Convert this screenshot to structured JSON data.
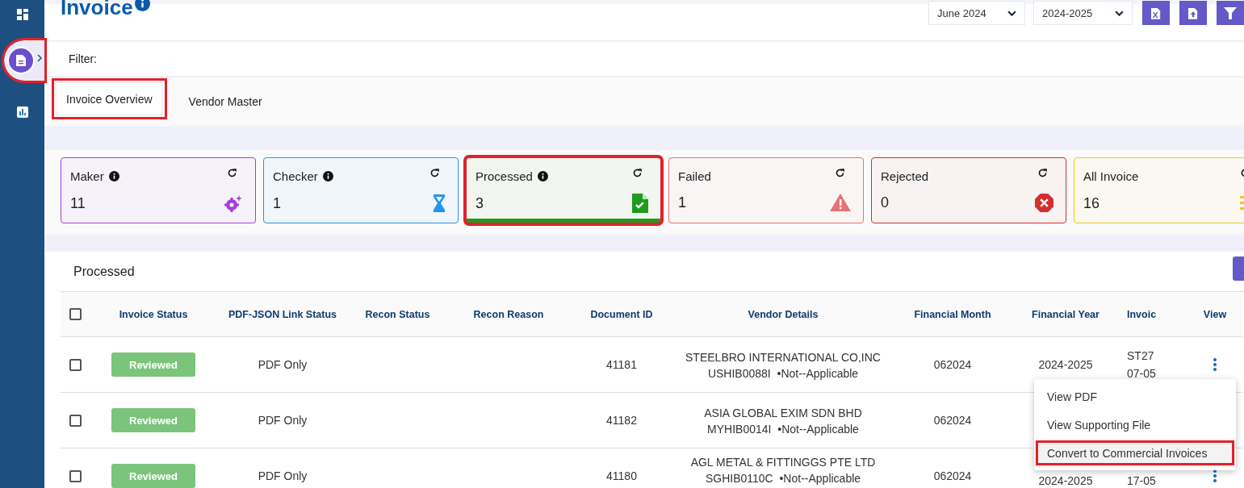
{
  "sidebar": {
    "items": [
      {
        "kind": "dashboard",
        "selected": false,
        "highlighted": false
      },
      {
        "kind": "document",
        "selected": true,
        "highlighted": true
      },
      {
        "kind": "chart",
        "selected": false,
        "highlighted": false
      }
    ]
  },
  "header": {
    "title": "Invoice",
    "month": "June 2024",
    "year": "2024-2025",
    "actions": [
      {
        "kind": "excel"
      },
      {
        "kind": "upload"
      },
      {
        "kind": "filter"
      }
    ]
  },
  "filter": {
    "label": "Filter:"
  },
  "tabs": [
    {
      "label": "Invoice Overview",
      "selected": true,
      "highlighted": true
    },
    {
      "label": "Vendor Master",
      "selected": false,
      "highlighted": false
    }
  ],
  "cards": [
    {
      "label": "Maker",
      "count": "11",
      "info": true,
      "kind": "gear",
      "color": "#a43fd9",
      "selected": false,
      "highlighted": false
    },
    {
      "label": "Checker",
      "count": "1",
      "info": true,
      "kind": "hourglass",
      "color": "#2196f3",
      "selected": false,
      "highlighted": false
    },
    {
      "label": "Processed",
      "count": "3",
      "info": true,
      "kind": "file-check",
      "color": "#1e9a1e",
      "selected": true,
      "highlighted": true
    },
    {
      "label": "Failed",
      "count": "1",
      "info": false,
      "kind": "warning",
      "color": "#e57373",
      "selected": false,
      "highlighted": false
    },
    {
      "label": "Rejected",
      "count": "0",
      "info": false,
      "kind": "cancel",
      "color": "#d32f2f",
      "selected": false,
      "highlighted": false
    },
    {
      "label": "All Invoice",
      "count": "16",
      "info": false,
      "kind": "list",
      "color": "#f5c518",
      "selected": false,
      "highlighted": false
    }
  ],
  "table": {
    "title": "Processed",
    "all_checked": false,
    "columns": [
      "Invoice Status",
      "PDF-JSON Link Status",
      "Recon Status",
      "Recon Reason",
      "Document ID",
      "Vendor Details",
      "Financial Month",
      "Financial Year",
      "Invoic",
      "View"
    ],
    "rows": [
      {
        "checked": false,
        "status": "Reviewed",
        "link_status": "PDF Only",
        "document_id": "41181",
        "vendor_name": "STEELBRO INTERNATIONAL CO,INC",
        "vendor_code": "USHIB0088I",
        "vendor_tag": "•Not--Applicable",
        "month": "062024",
        "year": "2024-2025",
        "invoice_id": "ST27",
        "invoice_date": "07-05",
        "menu_button": true
      },
      {
        "checked": false,
        "status": "Reviewed",
        "link_status": "PDF Only",
        "document_id": "41182",
        "vendor_name": "ASIA GLOBAL EXIM SDN BHD",
        "vendor_code": "MYHIB0014I",
        "vendor_tag": "•Not--Applicable",
        "month": "062024"
      },
      {
        "checked": false,
        "status": "Reviewed",
        "link_status": "PDF Only",
        "document_id": "41180",
        "vendor_name": "AGL METAL & FITTINGGS PTE LTD",
        "vendor_code": "SGHIB0110C",
        "vendor_tag": "•Not--Applicable",
        "month": "062024",
        "year": "2024-2025",
        "invoice_date": "17-05",
        "menu_button": true
      }
    ]
  },
  "menu": {
    "items": [
      {
        "label": "View PDF",
        "highlighted": false
      },
      {
        "label": "View Supporting File",
        "highlighted": false
      },
      {
        "label": "Convert to Commercial Invoices",
        "highlighted": true
      }
    ]
  }
}
